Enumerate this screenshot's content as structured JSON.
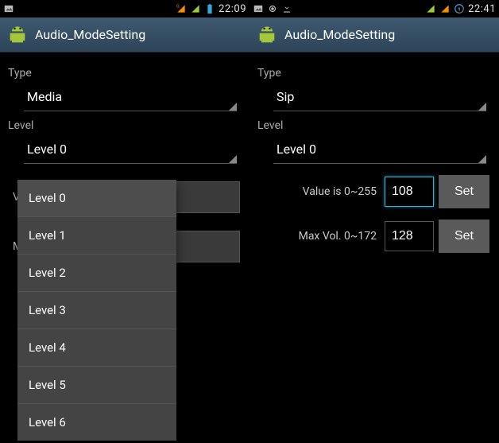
{
  "left": {
    "statusbar": {
      "time": "22:09"
    },
    "appbar": {
      "title": "Audio_ModeSetting"
    },
    "type_label": "Type",
    "type_value": "Media",
    "level_label": "Level",
    "level_value": "Level 0",
    "value_label_partial": "Valu",
    "max_label_partial": "Max",
    "dropdown_items": [
      "Level 0",
      "Level 1",
      "Level 2",
      "Level 3",
      "Level 4",
      "Level 5",
      "Level 6"
    ]
  },
  "right": {
    "statusbar": {
      "time": "22:41"
    },
    "appbar": {
      "title": "Audio_ModeSetting"
    },
    "type_label": "Type",
    "type_value": "Sip",
    "level_label": "Level",
    "level_value": "Level 0",
    "value_label": "Value is 0~255",
    "value_input": "108",
    "value_set": "Set",
    "max_label": "Max Vol. 0~172",
    "max_input": "128",
    "max_set": "Set"
  }
}
